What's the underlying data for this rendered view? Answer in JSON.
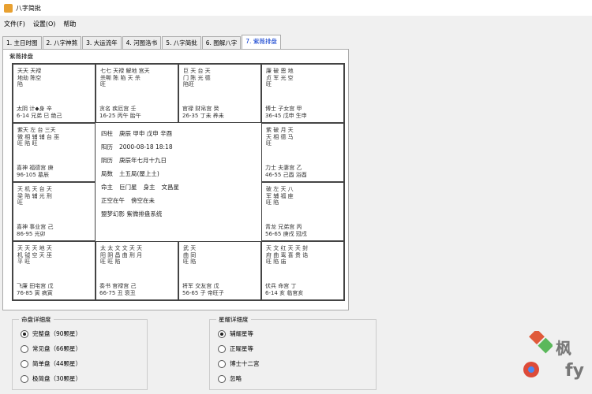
{
  "window": {
    "title": "八字简批"
  },
  "menu": [
    "文件(F)",
    "设置(O)",
    "帮助"
  ],
  "tabs": [
    {
      "label": "1. 主日时图",
      "active": false
    },
    {
      "label": "2. 八字神煞",
      "active": false
    },
    {
      "label": "3. 大运流年",
      "active": false
    },
    {
      "label": "4. 河图洛书",
      "active": false
    },
    {
      "label": "5. 八字简批",
      "active": false
    },
    {
      "label": "6. 图解八字",
      "active": false
    },
    {
      "label": "7. 紫薇排盘",
      "active": true
    }
  ],
  "panel": {
    "label": "紫薇排盘"
  },
  "palaces": [
    {
      "stars": "天天 天禄\n地劫 陈空\n陷",
      "foot": [
        "太阴 计◆身 辛",
        "6-14 兄弟 巳 绝己"
      ]
    },
    {
      "stars": "七七 天禄 解地 宫天\n杀嘶 陈 陷 天 杀\n旺",
      "foot": [
        "贪名 疾厄宫 壬",
        "16-25 丙午 胎午"
      ]
    },
    {
      "stars": "巨 天 台 天\n门 陈 光 德\n陷旺",
      "foot": [
        "官禄 财帛宫 癸",
        "26-35 丁未 养未"
      ]
    },
    {
      "stars": "廉 破 恩 地\n贞 军 光 空\n旺",
      "foot": [
        "博士 子女宫 甲",
        "36-45 戊申 生申"
      ]
    },
    {
      "stars": "紫天 左 台 三天\n微 相 辅 辅 台 巫\n旺 陷 旺",
      "foot": [
        "喜神 福德宫 庚",
        "96-105 墓辰"
      ]
    },
    {
      "stars": "紫 破 月 天\n天 相 德 马\n旺",
      "foot": [
        "力士 夫妻宫 乙",
        "46-55 己酉 浴酉"
      ]
    },
    {
      "stars": "天 机 天 台 天\n梁 陷 辅 光 刑\n旺",
      "foot": [
        "喜神 事业宫 己",
        "86-95 光卯"
      ]
    },
    {
      "stars": "破 左 天 八\n军 辅 福 座\n旺 陷",
      "foot": [
        "青龙 兄弟宫 丙",
        "56-65 庚戌 冠戌"
      ]
    },
    {
      "stars": "天 天 天 地 天\n机 钺 空 天 巫\n平 旺",
      "foot": [
        "飞廉 田宅宫 戊",
        "76-85 寅 病寅"
      ]
    },
    {
      "stars": "太 太 文 文 天 天\n阳 阴 昌 曲 刑 月\n旺 旺 陷",
      "foot": [
        "奏书 官禄宫 己",
        "66-75 丑 衰丑"
      ]
    },
    {
      "stars": "武 天\n曲 同\n旺 陷",
      "foot": [
        "将军 交友宫 戊",
        "56-65 子 帝旺子"
      ]
    },
    {
      "stars": "天 文 红 天 天 封\n府 曲 鸾 喜 贵 诰\n旺 陷 庙",
      "foot": [
        "伏兵 命宫 丁",
        "6-14 亥 临官亥"
      ]
    }
  ],
  "center": {
    "lines": [
      [
        "四柱",
        "庚辰 甲申 戊申 辛酉"
      ],
      [
        "阳历",
        "2000-08-18 18:18"
      ],
      [
        "阴历",
        "庚辰年七月十九日"
      ],
      [
        "局数",
        "土五局(屋上土)"
      ],
      [
        "命主",
        "巨门星",
        "身主",
        "文昌星"
      ],
      [
        "正空在午",
        "傍空在未"
      ],
      [
        "",
        "盟梦幻影 紫微排盘系统"
      ]
    ]
  },
  "bottom_left": {
    "label": "命盘详细度",
    "options": [
      {
        "label": "完整盘（90颗星）",
        "selected": true
      },
      {
        "label": "常见盘（66颗星）",
        "selected": false
      },
      {
        "label": "简单盘（44颗星）",
        "selected": false
      },
      {
        "label": "极简盘（30颗星）",
        "selected": false
      }
    ]
  },
  "bottom_right": {
    "label": "星耀详细度",
    "options": [
      {
        "label": "辅耀星等",
        "selected": true
      },
      {
        "label": "正曜星等",
        "selected": false
      },
      {
        "label": "博士十二宫",
        "selected": false
      },
      {
        "label": "忽略",
        "selected": false
      }
    ]
  },
  "watermark": {
    "text1": "枫",
    "text2": "fy"
  },
  "colors": {
    "active_tab": "#0033cc",
    "board_border": "#444444"
  }
}
